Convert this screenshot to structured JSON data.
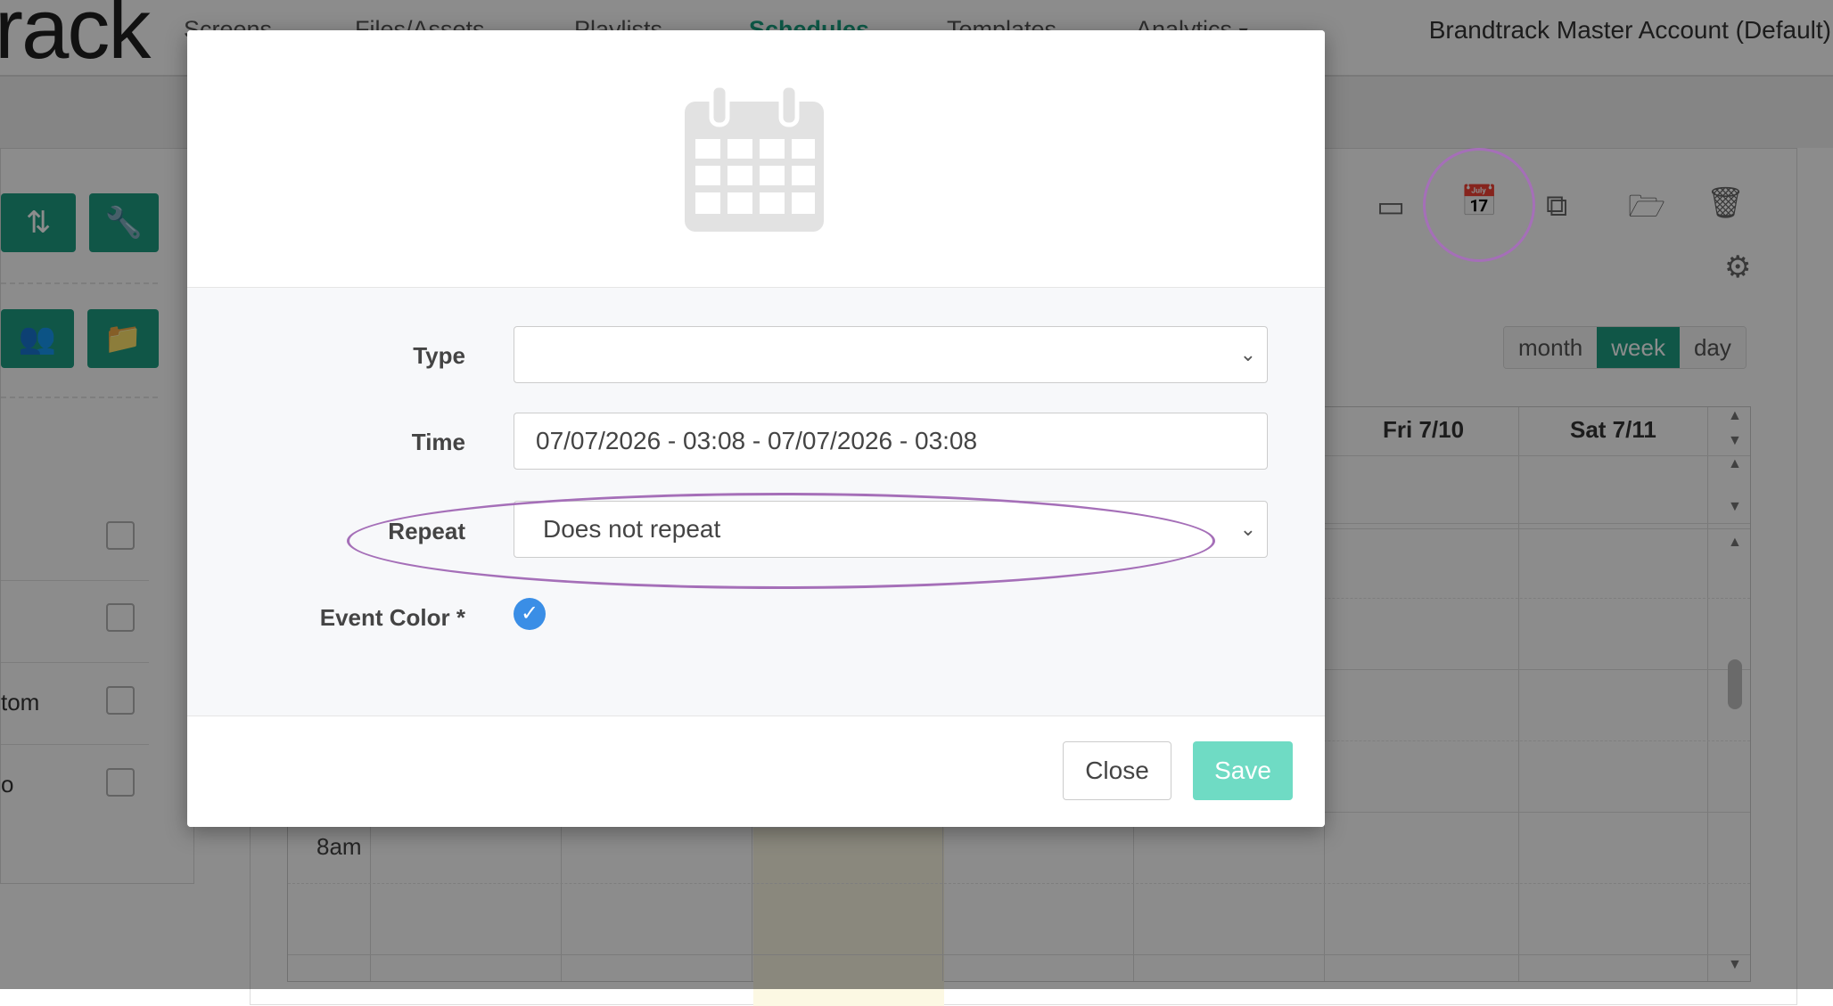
{
  "app": {
    "logo_text": "rack",
    "nav": [
      "Screens",
      "Files/Assets",
      "Playlists",
      "Schedules",
      "Templates",
      "Analytics"
    ],
    "active_nav": "Schedules",
    "account": "Brandtrack Master Account (Default)"
  },
  "left_panel": {
    "rows": [
      {
        "label": ""
      },
      {
        "label": ""
      },
      {
        "label": "tom"
      },
      {
        "label": "o"
      }
    ]
  },
  "calendar": {
    "view_buttons": [
      "month",
      "week",
      "day"
    ],
    "active_view": "week",
    "day_headers": [
      "Fri 7/10",
      "Sat 7/11"
    ],
    "time_label": "8am"
  },
  "modal": {
    "labels": {
      "type": "Type",
      "time": "Time",
      "repeat": "Repeat",
      "event_color": "Event Color *"
    },
    "type_value": "",
    "time_value": "07/07/2026 - 03:08 - 07/07/2026 - 03:08",
    "repeat_value": "Does not repeat",
    "close_label": "Close",
    "save_label": "Save"
  },
  "colors": {
    "accent": "#1e9d82",
    "save_button": "#6fdbc4",
    "highlight_ring": "#a56fb8",
    "color_check": "#3a8ee6"
  }
}
